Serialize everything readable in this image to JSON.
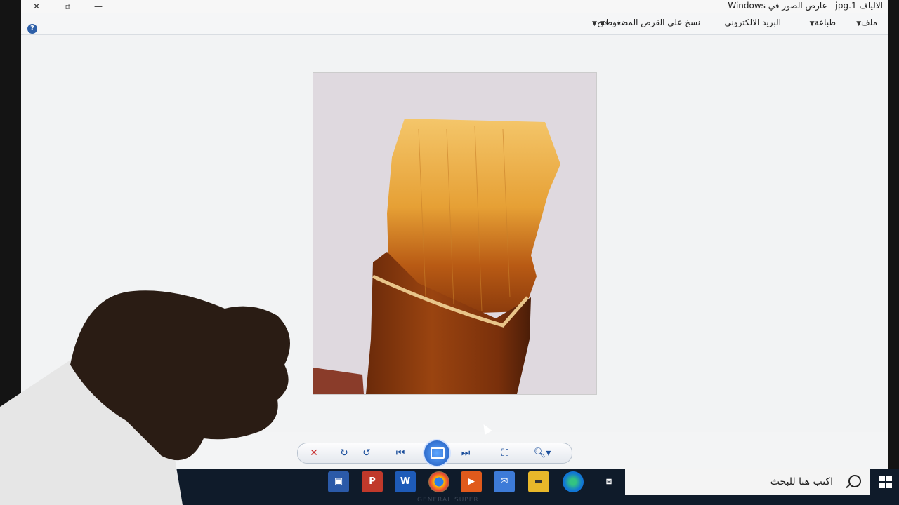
{
  "window": {
    "title": "الالياف jpg.1 - عارض الصور في Windows",
    "close_label": "✕",
    "restore_label": "⧉",
    "minimize_label": "—"
  },
  "menu": {
    "file": "ملف",
    "print": "طباعة",
    "email": "البريد الالكتروني",
    "burn": "نسخ على القرص المضغوط",
    "open": "فتح"
  },
  "nav": {
    "delete_icon": "delete-icon",
    "rotate_cw_icon": "rotate-clockwise-icon",
    "rotate_ccw_icon": "rotate-counterclockwise-icon",
    "prev_icon": "previous-icon",
    "slideshow_icon": "slideshow-icon",
    "next_icon": "next-icon",
    "fit_icon": "actual-size-icon",
    "zoom_icon": "zoom-icon"
  },
  "taskbar": {
    "search_placeholder": "اكتب هنا للبحث",
    "brand": "GENERAL SUPER",
    "apps": [
      "photo-viewer",
      "powerpoint",
      "word",
      "chrome",
      "media-player",
      "mail",
      "file-explorer",
      "edge",
      "task-view"
    ]
  },
  "colors": {
    "accent": "#1c4f9c",
    "taskbar": "#0f1b2a"
  }
}
